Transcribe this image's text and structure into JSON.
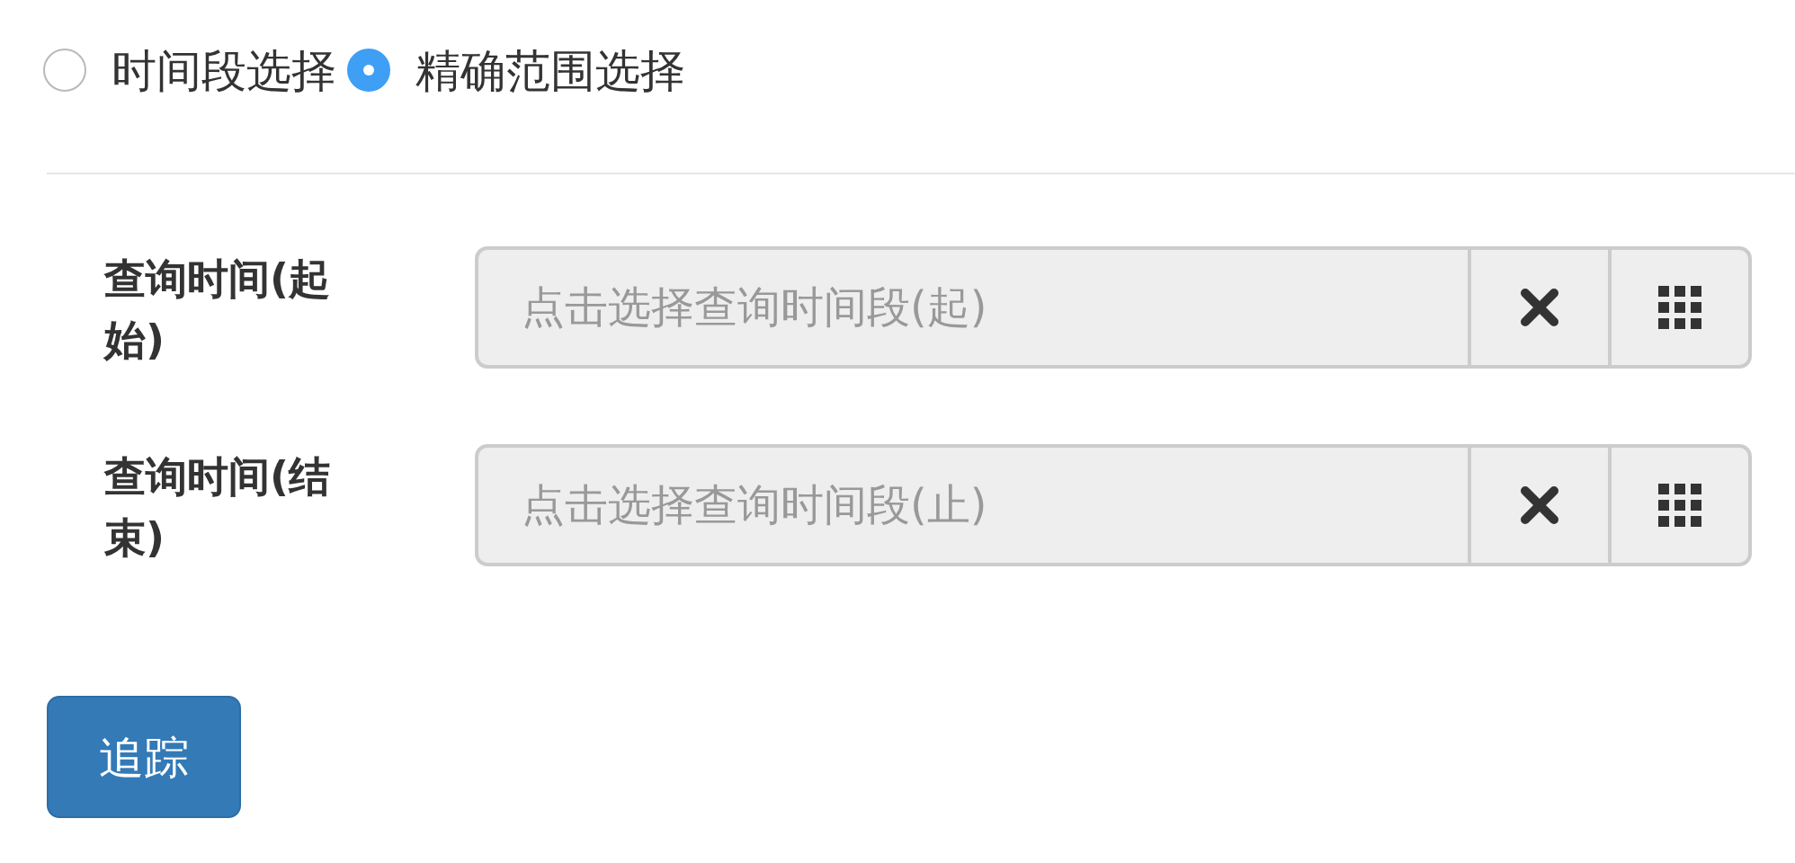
{
  "radio_options": [
    {
      "label": "时间段选择",
      "selected": false
    },
    {
      "label": "精确范围选择",
      "selected": true
    }
  ],
  "fields": [
    {
      "label": "查询时间(起始)",
      "placeholder": "点击选择查询时间段(起)"
    },
    {
      "label": "查询时间(结束)",
      "placeholder": "点击选择查询时间段(止)"
    }
  ],
  "submit_button": "追踪"
}
